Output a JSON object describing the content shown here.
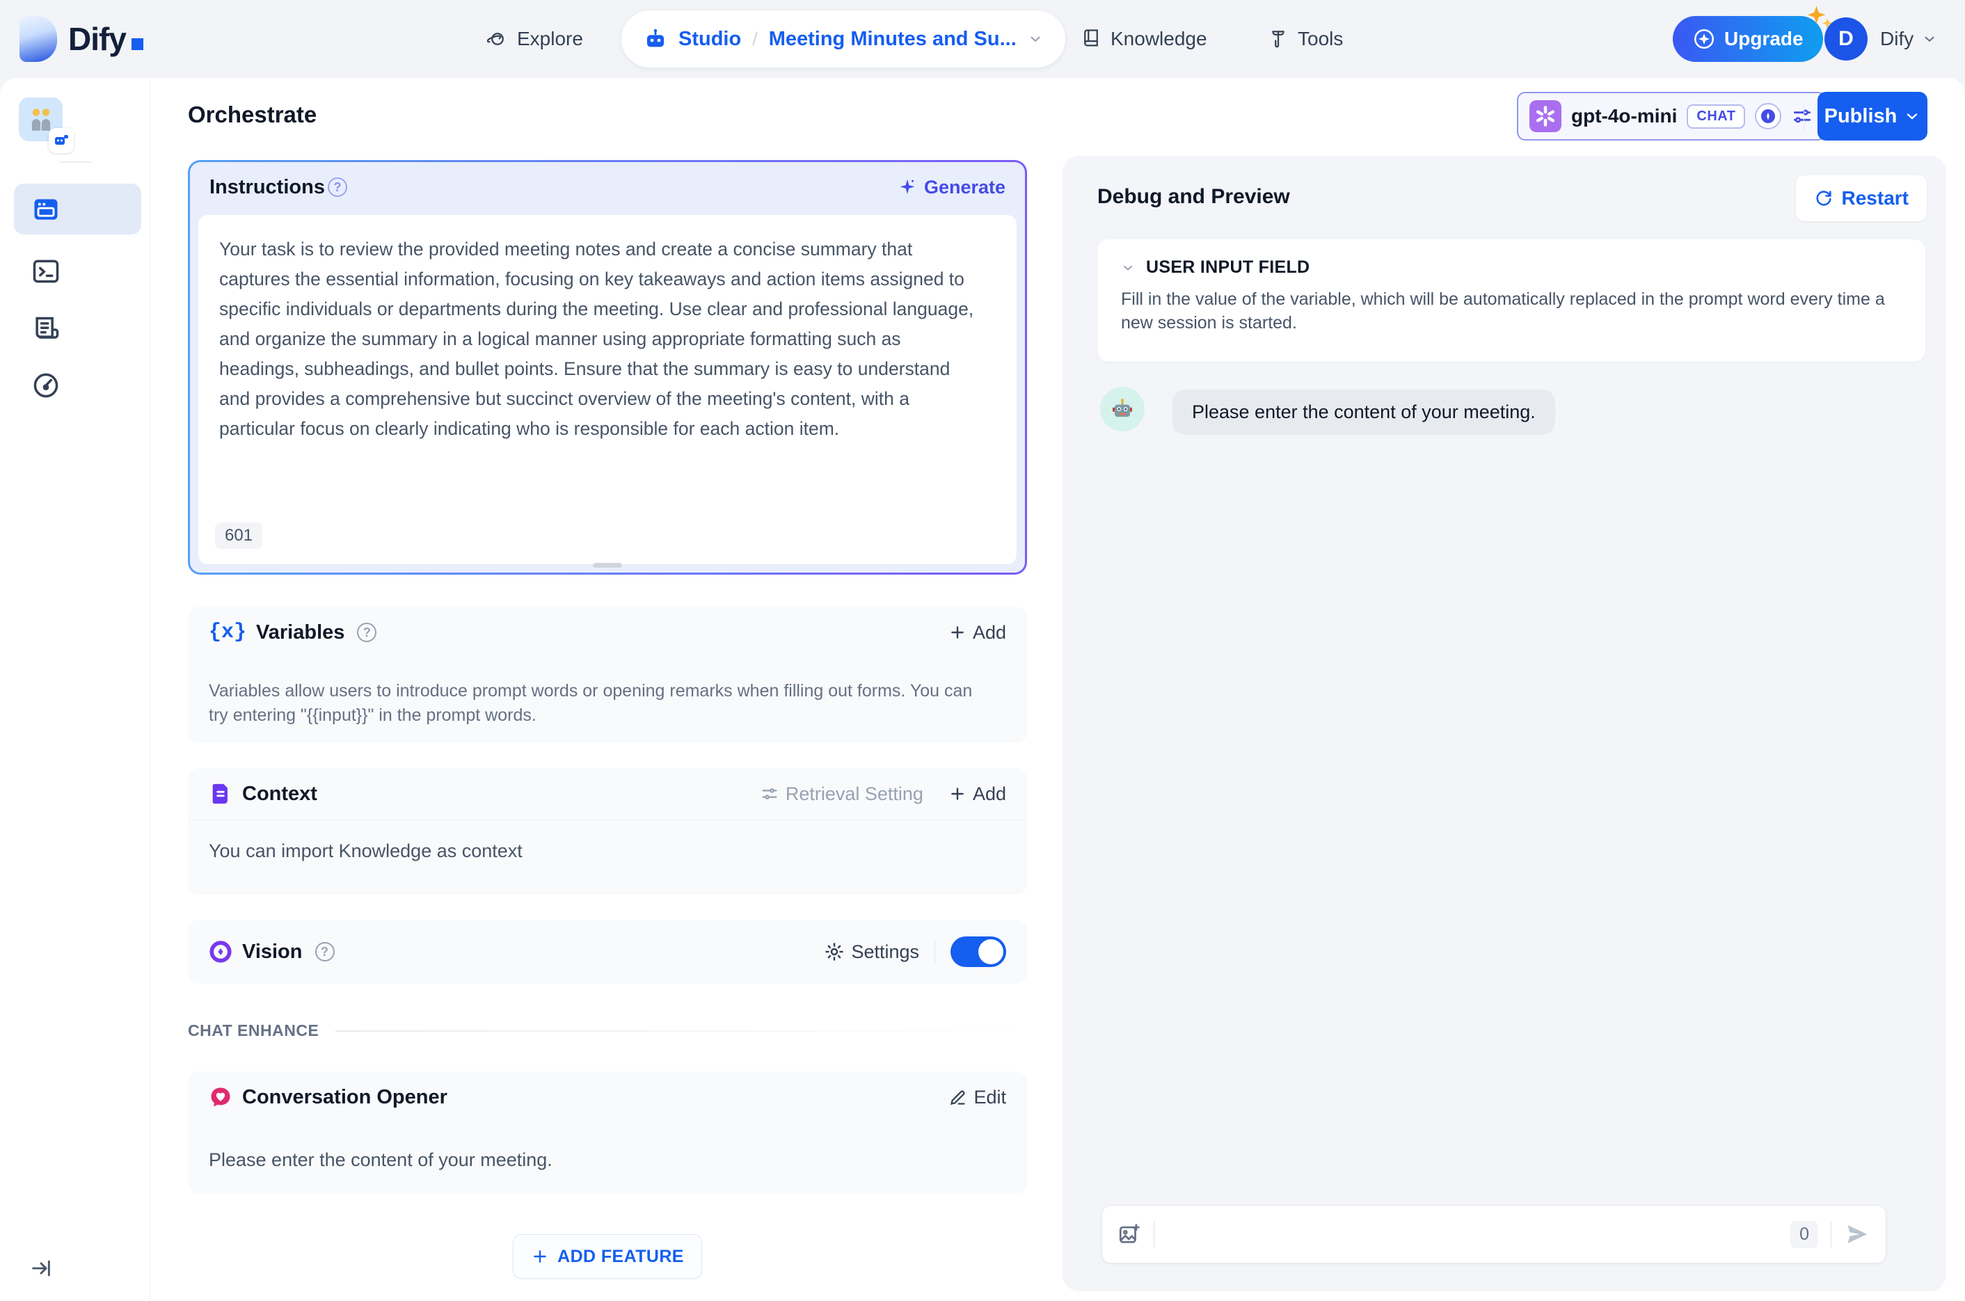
{
  "header": {
    "brand": "Dify",
    "explore": "Explore",
    "studio": "Studio",
    "breadcrumb_separator": "/",
    "breadcrumb_app": "Meeting Minutes and Su...",
    "knowledge": "Knowledge",
    "tools": "Tools",
    "upgrade": "Upgrade",
    "avatar_initial": "D",
    "account": "Dify"
  },
  "toolbar": {
    "page_title": "Orchestrate",
    "model_name": "gpt-4o-mini",
    "model_mode": "CHAT",
    "publish": "Publish"
  },
  "icons": {
    "help": "?",
    "variables_braces": "{x}"
  },
  "instructions": {
    "title": "Instructions",
    "generate": "Generate",
    "body": "Your task is to review the provided meeting notes and create a concise summary that captures the essential information, focusing on key takeaways and action items assigned to specific individuals or departments during the meeting. Use clear and professional language, and organize the summary in a logical manner using appropriate formatting such as headings, subheadings, and bullet points. Ensure that the summary is easy to understand and provides a comprehensive but succinct overview of the meeting's content, with a particular focus on clearly indicating who is responsible for each action item.",
    "char_count": "601"
  },
  "variables": {
    "title": "Variables",
    "add": "Add",
    "description": "Variables allow users to introduce prompt words or opening remarks when filling out forms. You can try entering \"{{input}}\" in the prompt words."
  },
  "context": {
    "title": "Context",
    "retrieval_setting": "Retrieval Setting",
    "add": "Add",
    "description": "You can import Knowledge as context"
  },
  "vision": {
    "title": "Vision",
    "settings": "Settings",
    "enabled": true
  },
  "chat_enhance": {
    "label": "CHAT ENHANCE"
  },
  "conversation_opener": {
    "title": "Conversation Opener",
    "edit": "Edit",
    "opening_statement": "Please enter the content of your meeting."
  },
  "add_feature": "ADD FEATURE",
  "debug": {
    "title": "Debug and Preview",
    "restart": "Restart",
    "user_input_field": {
      "title": "USER INPUT FIELD",
      "description": "Fill in the value of the variable, which will be automatically replaced in the prompt word every time a new session is started."
    },
    "assistant_message": "Please enter the content of your meeting.",
    "input_counter": "0"
  },
  "colors": {
    "primary": "#155eef",
    "indigo": "#444ce7",
    "purple": "#6938ef",
    "vision_purple": "#7839ee",
    "pink": "#e02a6f",
    "gradient_border": [
      "#56a0f8",
      "#7b5bf7"
    ]
  }
}
